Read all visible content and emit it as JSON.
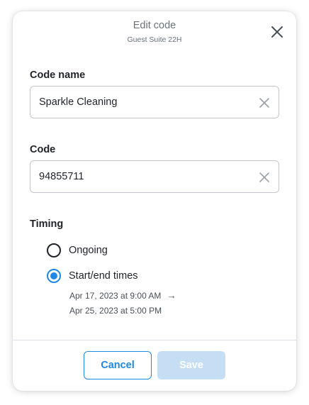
{
  "dialog": {
    "title": "Edit code",
    "subtitle": "Guest Suite 22H",
    "close_icon": "close-icon"
  },
  "code_name": {
    "label": "Code name",
    "value": "Sparkle Cleaning",
    "clear_icon": "clear-icon"
  },
  "code": {
    "label": "Code",
    "value": "94855711",
    "clear_icon": "clear-icon"
  },
  "timing": {
    "label": "Timing",
    "options": [
      {
        "label": "Ongoing",
        "selected": false
      },
      {
        "label": "Start/end times",
        "selected": true
      }
    ],
    "start": "Apr 17, 2023 at 9:00 AM",
    "arrow": "→",
    "end": "Apr 25, 2023 at 5:00 PM"
  },
  "footer": {
    "cancel_label": "Cancel",
    "save_label": "Save",
    "save_disabled": true
  },
  "colors": {
    "accent": "#1e88e5",
    "disabled_button": "#c5def4",
    "text": "#1f2329",
    "muted": "#6b7079"
  }
}
